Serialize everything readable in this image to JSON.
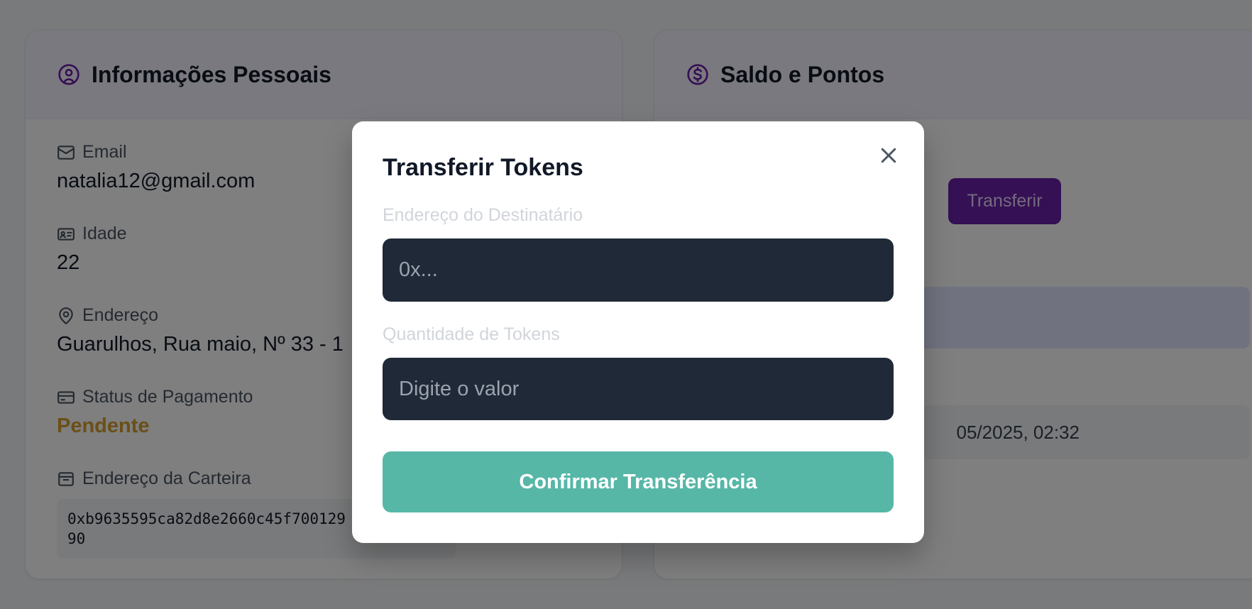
{
  "personal": {
    "title": "Informações Pessoais",
    "icon": "user-circle-icon",
    "email_label": "Email",
    "email_value": "natalia12@gmail.com",
    "age_label": "Idade",
    "age_value": "22",
    "address_label": "Endereço",
    "address_value": "Guarulhos, Rua maio, Nº 33 - 1",
    "payment_label": "Status de Pagamento",
    "payment_value": "Pendente",
    "wallet_label": "Endereço da Carteira",
    "wallet_value": "0xb9635595ca82d8e2660c45f700129\n90"
  },
  "balance": {
    "title": "Saldo e Pontos",
    "icon": "dollar-circle-icon",
    "transfer_button": "Transferir",
    "date_partial": "05/2025, 02:32"
  },
  "modal": {
    "title": "Transferir Tokens",
    "recipient_label": "Endereço do Destinatário",
    "recipient_placeholder": "0x...",
    "recipient_value": "",
    "amount_label": "Quantidade de Tokens",
    "amount_placeholder": "Digite o valor",
    "amount_value": "",
    "confirm_button": "Confirmar Transferência"
  },
  "colors": {
    "accent_purple": "#6b21a8",
    "confirm_teal": "#56b7a7",
    "pending_amber": "#d69e2e",
    "input_dark": "#1f2937"
  }
}
